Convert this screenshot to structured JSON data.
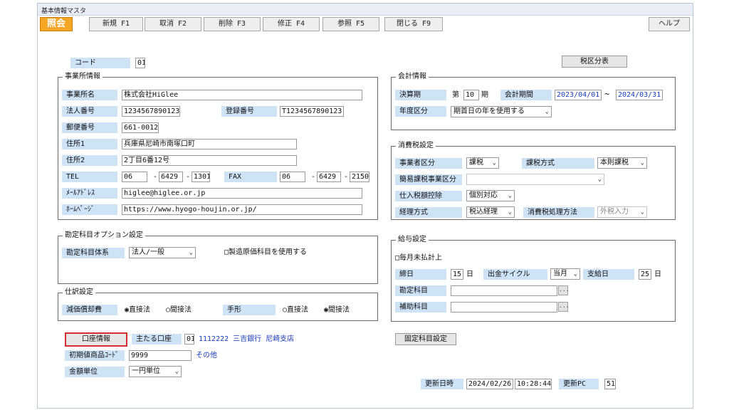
{
  "window": {
    "title": "基本情報マスタ"
  },
  "mode_badge": "照会",
  "toolbar": {
    "new": "新規 F1",
    "cancel": "取消 F2",
    "delete": "削除 F3",
    "modify": "修正 F4",
    "reference": "参照 F5",
    "close": "閉じる F9",
    "help": "ヘルプ"
  },
  "code": {
    "label": "コード",
    "value": "01"
  },
  "tax_table_button": "税区分表",
  "office": {
    "title": "事業所情報",
    "name_label": "事業所名",
    "name_value": "株式会社HiGlee",
    "corp_no_label": "法人番号",
    "corp_no_value": "1234567890123",
    "reg_no_label": "登録番号",
    "reg_no_value": "T1234567890123",
    "zip_label": "郵便番号",
    "zip_value": "661-0012",
    "addr1_label": "住所1",
    "addr1_value": "兵庫県尼崎市南塚口町",
    "addr2_label": "住所2",
    "addr2_value": "2丁目6番12号",
    "tel_label": "TEL",
    "tel": [
      "06",
      "6429",
      "1301"
    ],
    "fax_label": "FAX",
    "fax": [
      "06",
      "6429",
      "2150"
    ],
    "dash": "-",
    "mail_label": "ﾒｰﾙｱﾄﾞﾚｽ",
    "mail_value": "higlee@higlee.or.jp",
    "hp_label": "ﾎｰﾑﾍﾟｰｼﾞ",
    "hp_value": "https://www.hyogo-houjin.or.jp/"
  },
  "account_options": {
    "title": "勘定科目オプション設定",
    "system_label": "勘定科目体系",
    "system_value": "法人/一般",
    "mfg_checkbox": "□製造原価科目を使用する"
  },
  "journal": {
    "title": "仕訳設定",
    "depr_label": "減価償却費",
    "depr_options": [
      "◉直接法",
      "○間接法"
    ],
    "bill_label": "手形",
    "bill_options": [
      "○直接法",
      "◉間接法"
    ]
  },
  "accounting": {
    "title": "会計情報",
    "fiscal_label": "決算期",
    "fiscal_prefix": "第",
    "fiscal_no": "10",
    "fiscal_suffix": "期",
    "period_label": "会計期間",
    "period_start": "2023/04/01",
    "period_tilde": "~",
    "period_end": "2024/03/31",
    "year_label": "年度区分",
    "year_value": "期首日の年を使用する"
  },
  "consumption_tax": {
    "title": "消費税設定",
    "biz_label": "事業者区分",
    "biz_value": "課税",
    "method_label": "課税方式",
    "method_value": "本則課税",
    "simple_label": "簡易課税事業区分",
    "simple_value": "",
    "deduction_label": "仕入税額控除",
    "deduction_value": "個別対応",
    "acct_label": "経理方式",
    "acct_value": "税込経理",
    "process_label": "消費税処理方法",
    "process_value": "外税入力"
  },
  "payroll": {
    "title": "給与設定",
    "unpaid_checkbox": "□毎月未払計上",
    "close_label": "締日",
    "close_value": "15",
    "close_unit": "日",
    "cycle_label": "出金サイクル",
    "cycle_value": "当月",
    "pay_label": "支給日",
    "pay_value": "25",
    "pay_unit": "日",
    "account_label": "勘定科目",
    "sub_label": "補助科目",
    "dots": "..."
  },
  "bank": {
    "button": "口座情報",
    "main_label": "主たる口座",
    "main_no": "01",
    "main_detail": "1112222 三吉銀行 尼崎支店"
  },
  "fixed_button": "固定科目設定",
  "initial": {
    "label": "初期値商品ｺｰﾄﾞ",
    "value": "9999",
    "other": "その他"
  },
  "amount_unit": {
    "label": "金額単位",
    "value": "一円単位"
  },
  "updated": {
    "label": "更新日時",
    "date": "2024/02/26",
    "time": "10:28:44",
    "pc_label": "更新PC",
    "pc_value": "51"
  },
  "colors": {
    "label_bg": "#cfe3f7",
    "mode_badge": "#f5a623",
    "highlight": "#d32f2f",
    "link": "#1a3dbf"
  }
}
